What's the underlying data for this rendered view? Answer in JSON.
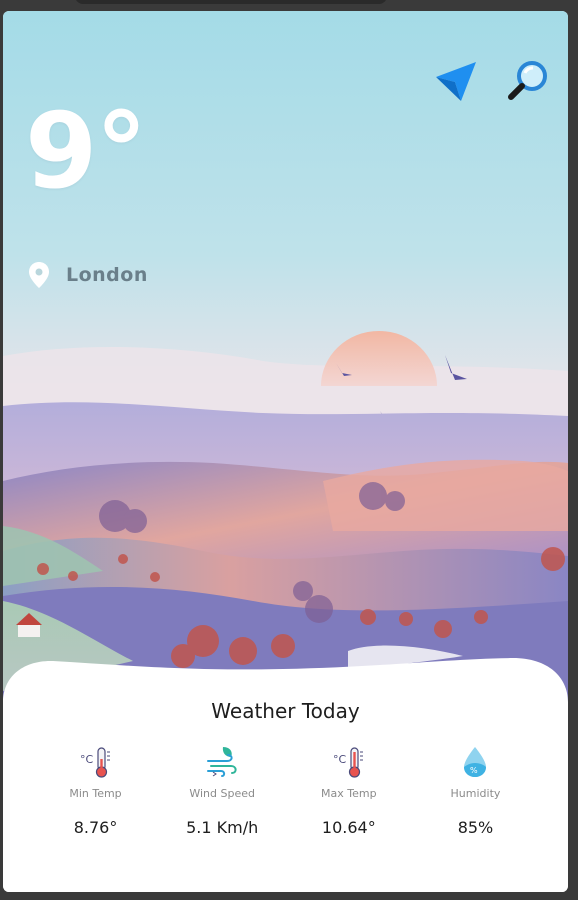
{
  "weather": {
    "temperature": "9°",
    "city": "London"
  },
  "actions": {
    "locate_icon": "navigation-arrow-icon",
    "search_icon": "magnifier-icon"
  },
  "today": {
    "title": "Weather Today",
    "stats": [
      {
        "label": "Min Temp",
        "value": "8.76°",
        "icon": "thermometer-cold-icon"
      },
      {
        "label": "Wind Speed",
        "value": "5.1 Km/h",
        "icon": "wind-leaf-icon"
      },
      {
        "label": "Max Temp",
        "value": "10.64°",
        "icon": "thermometer-hot-icon"
      },
      {
        "label": "Humidity",
        "value": "85%",
        "icon": "water-drop-icon"
      }
    ]
  },
  "colors": {
    "sky_top": "#a9dde8",
    "sky_bottom": "#f0e1e6",
    "hills_purple": "#8a86c4",
    "hills_pink": "#e2a49a",
    "accent_blue": "#1f8ff0",
    "text_dark": "#1e1e1e",
    "text_muted": "#8b8b8b"
  }
}
